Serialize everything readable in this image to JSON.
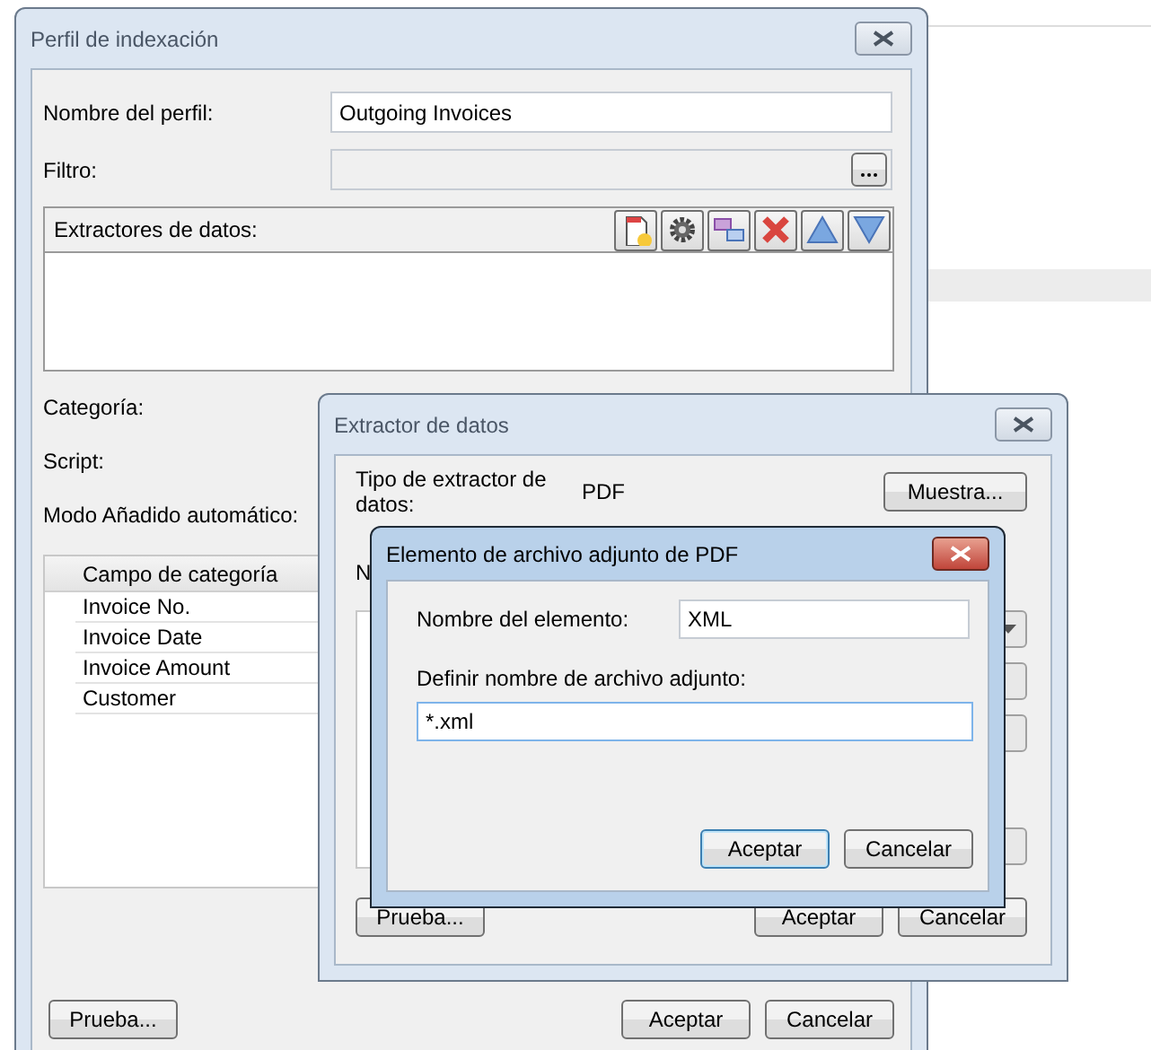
{
  "profile_window": {
    "title": "Perfil de indexación",
    "active": false,
    "fields": [
      {
        "kind": "text",
        "label": "Nombre del perfil:",
        "value": "Outgoing Invoices"
      },
      {
        "kind": "browse",
        "label": "Filtro:",
        "disabled": true
      }
    ],
    "extractors": {
      "label": "Extractores de datos:",
      "tools": [
        {
          "kind": "new"
        },
        {
          "kind": "settings"
        },
        {
          "kind": "link"
        },
        {
          "kind": "delete"
        },
        {
          "kind": "up"
        },
        {
          "kind": "down"
        }
      ]
    },
    "labels": [
      "Categoría:",
      "Script:",
      "Modo Añadido automático:"
    ],
    "table": {
      "columns": [
        "Campo de categoría"
      ],
      "rows": [
        "Invoice No.",
        "Invoice Date",
        "Invoice Amount",
        "Customer"
      ]
    },
    "buttons": [
      {
        "label": "Prueba...",
        "kind": "left"
      },
      {
        "label": "Aceptar",
        "kind": "right"
      },
      {
        "label": "Cancelar",
        "kind": "right"
      }
    ]
  },
  "extractor_window": {
    "title": "Extractor de datos",
    "active": false,
    "type_label": "Tipo de extractor de datos:",
    "type_value": "PDF",
    "sample_button": "Muestra...",
    "partial_label": "N",
    "buttons": [
      {
        "label": "Prueba...",
        "kind": "left"
      },
      {
        "label": "Aceptar",
        "kind": "right"
      },
      {
        "label": "Cancelar",
        "kind": "right"
      }
    ]
  },
  "attachment_window": {
    "title": "Elemento de archivo adjunto de PDF",
    "active": true,
    "fields": [
      {
        "label": "Nombre del elemento:",
        "value": "XML",
        "focused": false,
        "kind": "inline"
      },
      {
        "label": "Definir nombre de archivo adjunto:",
        "value": "*.xml",
        "focused": true,
        "kind": "stacked"
      }
    ],
    "buttons": [
      {
        "label": "Aceptar",
        "focused": true
      },
      {
        "label": "Cancelar",
        "focused": false
      }
    ]
  }
}
